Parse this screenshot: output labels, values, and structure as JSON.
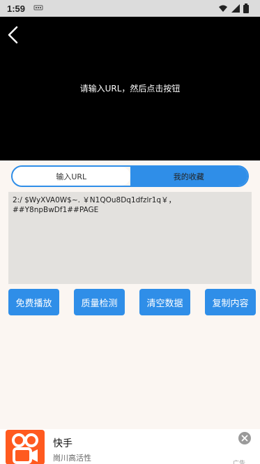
{
  "status_bar": {
    "time": "1:59",
    "notification_icon": "sim-icon"
  },
  "player": {
    "message": "请输入URL，然后点击按钮"
  },
  "tabs": [
    {
      "label": "输入URL"
    },
    {
      "label": "我的收藏"
    }
  ],
  "input": {
    "value": "2:/ $WyXVA0W$~. ￥N1QOu8Dq1dfzlr1q￥，\n##Y8npBwDf1##PAGE"
  },
  "buttons": {
    "play": "免费播放",
    "quality": "质量检测",
    "clear": "清空数据",
    "copy": "复制内容"
  },
  "ad": {
    "title": "快手",
    "subtitle": "崗川高活性",
    "tag": "广告"
  },
  "colors": {
    "accent": "#2f8ee8",
    "player_bg": "#000000",
    "content_bg": "#fbf6f2",
    "textarea_bg": "#e3e1de",
    "ad_logo": "#ff5a1f"
  }
}
